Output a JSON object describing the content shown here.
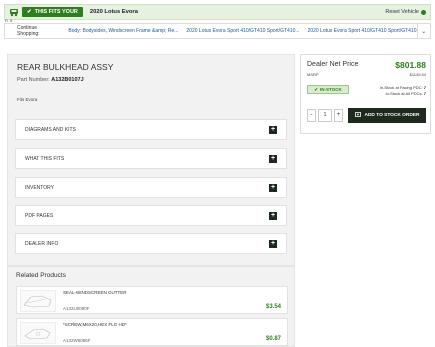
{
  "fitment": {
    "badge_label": "THIS FITS YOUR",
    "vehicle": "2020 Lotus Evora",
    "sub_label": "R. 8",
    "reset_label": "Reset Vehicle"
  },
  "continue_shopping": {
    "label": "Continue Shopping:",
    "links": [
      "Body: Bodysides, Windscreen Frame &amp; Re...",
      "2020 Lotus Evora Sport 410/GT410 Sport/GT410...",
      "2020 Lotus Evora Sport 410/GT410 Sport/GT410"
    ]
  },
  "part": {
    "title": "REAR BULKHEAD ASSY",
    "number_label": "Part Number:",
    "number": "A132B0107J",
    "fits": "Fits Evora"
  },
  "accordions": [
    {
      "label": "DIAGRAMS AND KITS"
    },
    {
      "label": "WHAT THIS FITS"
    },
    {
      "label": "INVENTORY"
    },
    {
      "label": "PDF PAGES"
    },
    {
      "label": "DEALER INFO"
    }
  ],
  "related": {
    "title": "Related Products",
    "products": [
      {
        "name": "SEAL-WINDSCREEN GUTTER",
        "number": "A132U0090F",
        "price": "$3.54"
      },
      {
        "name": "*SCREW,M6X20,HEX FLG HD*",
        "number": "A132W5085F",
        "price": "$0.87"
      }
    ]
  },
  "pricing": {
    "dnp_label": "Dealer Net Price",
    "dnp_value": "$801.88",
    "msrp_label": "MSRP",
    "msrp_value": "$1145.54",
    "stock_badge": "IN-STOCK",
    "stock_facing_label": "In-Stock at Facing PDC:",
    "stock_facing_value": "7",
    "stock_all_label": "In-Stock at All PDCs:",
    "stock_all_value": "7",
    "qty_minus": "-",
    "qty_value": "1",
    "qty_plus": "+",
    "add_label": "ADD TO STOCK ORDER"
  },
  "colors": {
    "accent_green": "#2e7d1e",
    "dark_button": "#1f2a1f",
    "link_blue": "#1a5ba6"
  }
}
